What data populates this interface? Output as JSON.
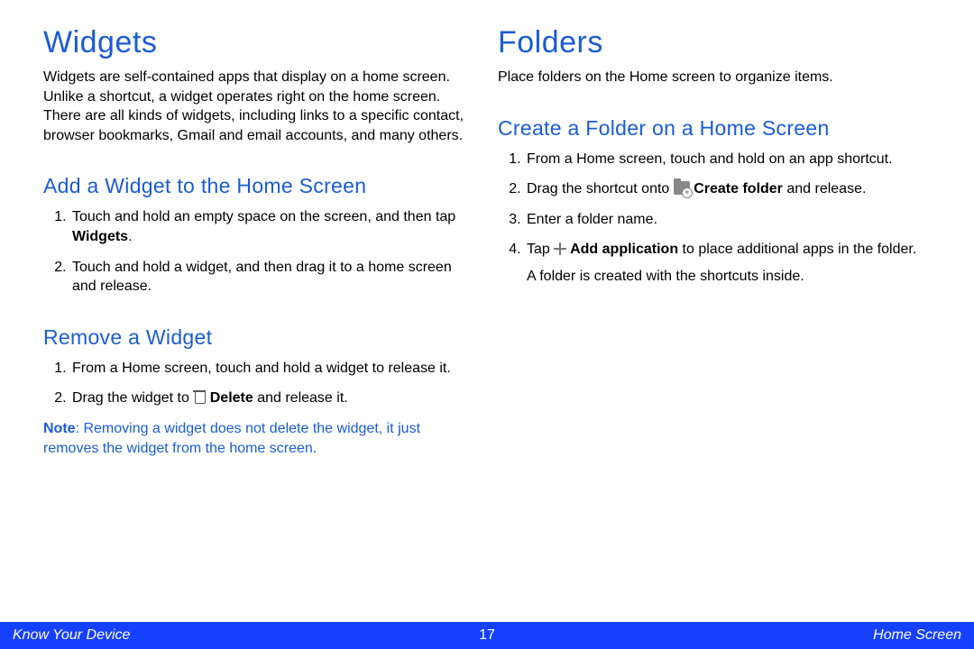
{
  "left": {
    "h1": "Widgets",
    "intro": "Widgets are self-contained apps that display on a home screen. Unlike a shortcut, a widget operates right on the home screen. There are all kinds of widgets, including links to a specific contact, browser bookmarks, Gmail and email accounts, and many others.",
    "add_h2": "Add a Widget to the Home Screen",
    "add_steps": {
      "s1a": "Touch and hold an empty space on the screen, and then tap ",
      "s1b": "Widgets",
      "s1c": ".",
      "s2": "Touch and hold a widget, and then drag it to a home screen and release."
    },
    "remove_h2": "Remove a Widget",
    "remove_steps": {
      "s1": "From a Home screen, touch and hold a widget to release it.",
      "s2a": "Drag the widget to ",
      "s2b": " Delete",
      "s2c": " and release it."
    },
    "note_label": "Note",
    "note_body": ": Removing a widget does not delete the widget, it just removes the widget from the home screen."
  },
  "right": {
    "h1": "Folders",
    "intro": "Place folders on the Home screen to organize items.",
    "create_h2": "Create a Folder on a Home Screen",
    "steps": {
      "s1": "From a Home screen, touch and hold on an app shortcut.",
      "s2a": "Drag the shortcut onto ",
      "s2b": " Create folder",
      "s2c": " and release.",
      "s3": "Enter a folder name.",
      "s4a": "Tap ",
      "s4b": " Add application",
      "s4c": " to place additional apps in the folder.",
      "s4_tail": "A folder is created with the shortcuts inside."
    }
  },
  "footer": {
    "left": "Know Your Device",
    "page": "17",
    "right": "Home Screen"
  }
}
